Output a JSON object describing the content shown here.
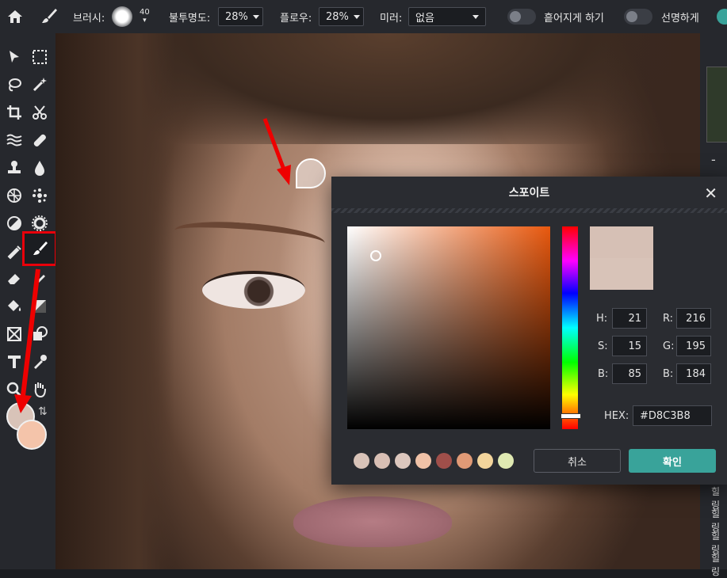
{
  "toolbar": {
    "brush_label": "브러시:",
    "brush_size": "40",
    "opacity_label": "불투명도:",
    "opacity_value": "28%",
    "flow_label": "플로우:",
    "flow_value": "28%",
    "mirror_label": "미러:",
    "mirror_value": "없음",
    "scatter_label": "흩어지게 하기",
    "sharpen_label": "선명하게"
  },
  "right_panel": {
    "minus": "-",
    "labels": [
      "힐링",
      "힐링",
      "힐링",
      "힐링"
    ]
  },
  "colors": {
    "foreground": "#d8c3b8",
    "background": "#f4c4aa",
    "accent": "#39a39a",
    "highlight": "#e8000a"
  },
  "dialog": {
    "title": "스포이트",
    "close": "✕",
    "h_label": "H:",
    "h_value": "21",
    "s_label": "S:",
    "s_value": "15",
    "b_label": "B:",
    "b_value": "85",
    "r_label": "R:",
    "r_value": "216",
    "g_label": "G:",
    "g_value": "195",
    "bl_label": "B:",
    "bl_value": "184",
    "hex_label": "HEX:",
    "hex_value": "#D8C3B8",
    "swatches": [
      "#d8c3b8",
      "#d8bfb4",
      "#dcc7bd",
      "#f0c2a7",
      "#a04f4a",
      "#e09a76",
      "#f3d59c",
      "#dfe9b2"
    ],
    "cancel_label": "취소",
    "ok_label": "확인"
  },
  "tools": [
    "move-icon",
    "marquee-icon",
    "lasso-icon",
    "wand-icon",
    "crop-icon",
    "scissors-icon",
    "liquify-icon",
    "bandage-icon",
    "stamp-icon",
    "drop-icon",
    "pattern-icon",
    "spot-icon",
    "dodge-icon",
    "sponge-icon",
    "pen-icon",
    "brush-icon",
    "eraser-icon",
    "pencil-icon",
    "bucket-icon",
    "gradient-icon",
    "frame-icon",
    "shape-icon",
    "text-icon",
    "eyedropper-icon",
    "zoom-icon",
    "hand-icon"
  ]
}
